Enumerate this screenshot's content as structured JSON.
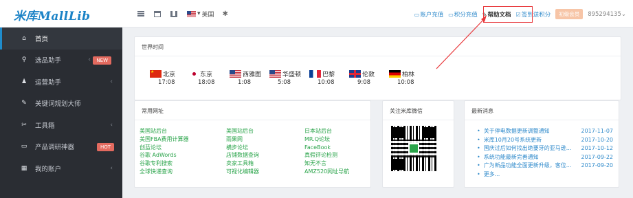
{
  "logo": "米库MallLib",
  "topbar": {
    "lang_label": "美国",
    "right_links": [
      {
        "label": "账户充值",
        "icon": "wallet-icon"
      },
      {
        "label": "积分充值",
        "icon": "coin-icon"
      },
      {
        "label": "帮助文档",
        "icon": "doc-icon"
      },
      {
        "label": "签到送积分",
        "icon": "checkin-icon"
      }
    ],
    "vip_label": "初级会员",
    "user": "895294135"
  },
  "sidebar": {
    "items": [
      {
        "label": "首页",
        "icon": "home-icon",
        "active": true
      },
      {
        "label": "选品助手",
        "icon": "search-icon",
        "badge": "NEW",
        "chevron": true
      },
      {
        "label": "运营助手",
        "icon": "user-icon",
        "chevron": true
      },
      {
        "label": "关键词规划大师",
        "icon": "edit-icon"
      },
      {
        "label": "工具箱",
        "icon": "wrench-icon",
        "chevron": true
      },
      {
        "label": "产品调研神器",
        "icon": "monitor-icon",
        "badge": "HOT"
      },
      {
        "label": "我的账户",
        "icon": "grid-icon",
        "chevron": true
      }
    ]
  },
  "world_time": {
    "title": "世界时间",
    "clocks": [
      {
        "city": "北京",
        "time": "17:08",
        "flag": "cn"
      },
      {
        "city": "东京",
        "time": "18:08",
        "flag": "jp"
      },
      {
        "city": "西雅图",
        "time": "1:08",
        "flag": "us"
      },
      {
        "city": "华盛顿",
        "time": "5:08",
        "flag": "us"
      },
      {
        "city": "巴黎",
        "time": "10:08",
        "flag": "fr"
      },
      {
        "city": "伦敦",
        "time": "9:08",
        "flag": "gb"
      },
      {
        "city": "柏林",
        "time": "10:08",
        "flag": "de"
      }
    ]
  },
  "sites": {
    "title": "常用网址",
    "links": [
      "美国站后台",
      "美国站后台",
      "日本站后台",
      "美国FBA费用计算器",
      "雨果网",
      "MR.Q论坛",
      "创蓝论坛",
      "横步论坛",
      "FaceBook",
      "谷歌 AdWords",
      "店铺数据查询",
      "真假评论检测",
      "谷歌专利搜索",
      "卖家工具箱",
      "知无不言",
      "全球快递查询",
      "可视化编辑器",
      "AMZ520网址导航"
    ]
  },
  "wechat": {
    "title": "关注米库微信"
  },
  "news": {
    "title": "最新消息",
    "items": [
      {
        "title": "关于停电数据更新调整通知",
        "date": "2017-11-07"
      },
      {
        "title": "米库10月20号系统更新",
        "date": "2017-10-20"
      },
      {
        "title": "国庆过后如何找出绝要牙的亚马逊...",
        "date": "2017-10-12"
      },
      {
        "title": "系统功能最新完善通知",
        "date": "2017-09-22"
      },
      {
        "title": "广为新品功能全面更新升级，客位...",
        "date": "2017-09-20"
      },
      {
        "title": "更多...",
        "date": ""
      }
    ]
  },
  "colors": {
    "accent": "#1f8ccc",
    "link_green": "#2aa44a",
    "badge": "#e36a5f",
    "sidebar_bg": "#2a2d33",
    "highlight": "#e8373a"
  }
}
